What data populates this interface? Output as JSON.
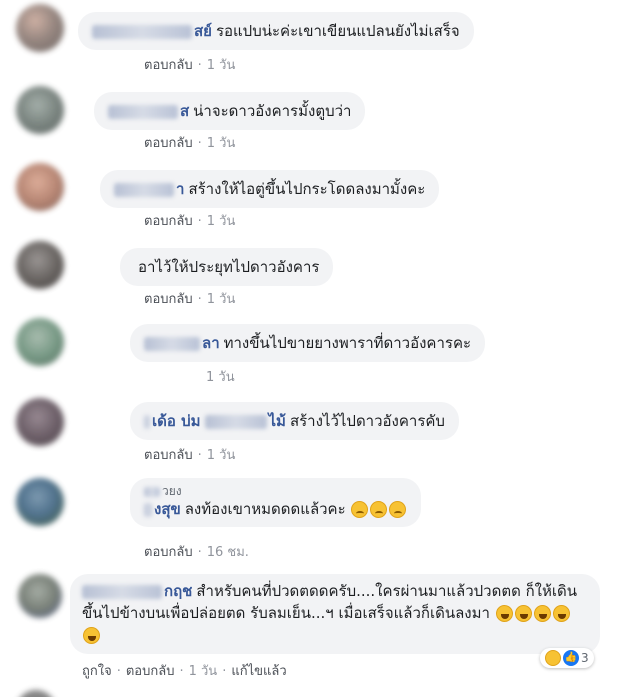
{
  "comments": [
    {
      "name": "สย์",
      "text": "รอแปบน่ะค่ะเขาเขียนแปลนยังไม่เสร็จ",
      "reply": "ตอบกลับ",
      "time": "1 วัน"
    },
    {
      "name": "ส",
      "text": "น่าจะดาวอังคารมั้งตูบว่า",
      "reply": "ตอบกลับ",
      "time": "1 วัน"
    },
    {
      "name": "า",
      "text": "สร้างให้ไอตู่ขึ้นไปกระโดดลงมามั้งคะ",
      "reply": "ตอบกลับ",
      "time": "1 วัน"
    },
    {
      "name": "",
      "text": "อาไว้ให้ประยุทไปดาวอังคาร",
      "reply": "ตอบกลับ",
      "time": "1 วัน"
    },
    {
      "name": "ลา",
      "text": "ทางขึ้นไปขายยางพาราที่ดาวอังคารคะ",
      "reply": "",
      "time": "1 วัน"
    },
    {
      "name": "เด้อ บ่ม",
      "name_tail": "ไม้",
      "text": "สร้างไว้ไปดาวอังคารคับ",
      "reply": "ตอบกลับ",
      "time": "1 วัน"
    },
    {
      "name_top": "วยง",
      "name": "งสุข",
      "text": "ลงท้องเขาหมดดดแล้วคะ",
      "reply": "ตอบกลับ",
      "time": "16 ชม."
    },
    {
      "name": "กฤช",
      "text": "สำหรับคนที่ปวดตดดครับ....ใครผ่านมาแล้วปวดตด ก็ให้เดินขึ้นไปข้างบนเพื่อปล่อยตด รับลมเย็น...ฯ เมื่อเสร็จแล้วก็เดินลงมา",
      "like": "ถูกใจ",
      "reply": "ตอบกลับ",
      "time": "1 วัน",
      "edited": "แก้ไขแล้ว",
      "reaction_count": "3"
    }
  ]
}
